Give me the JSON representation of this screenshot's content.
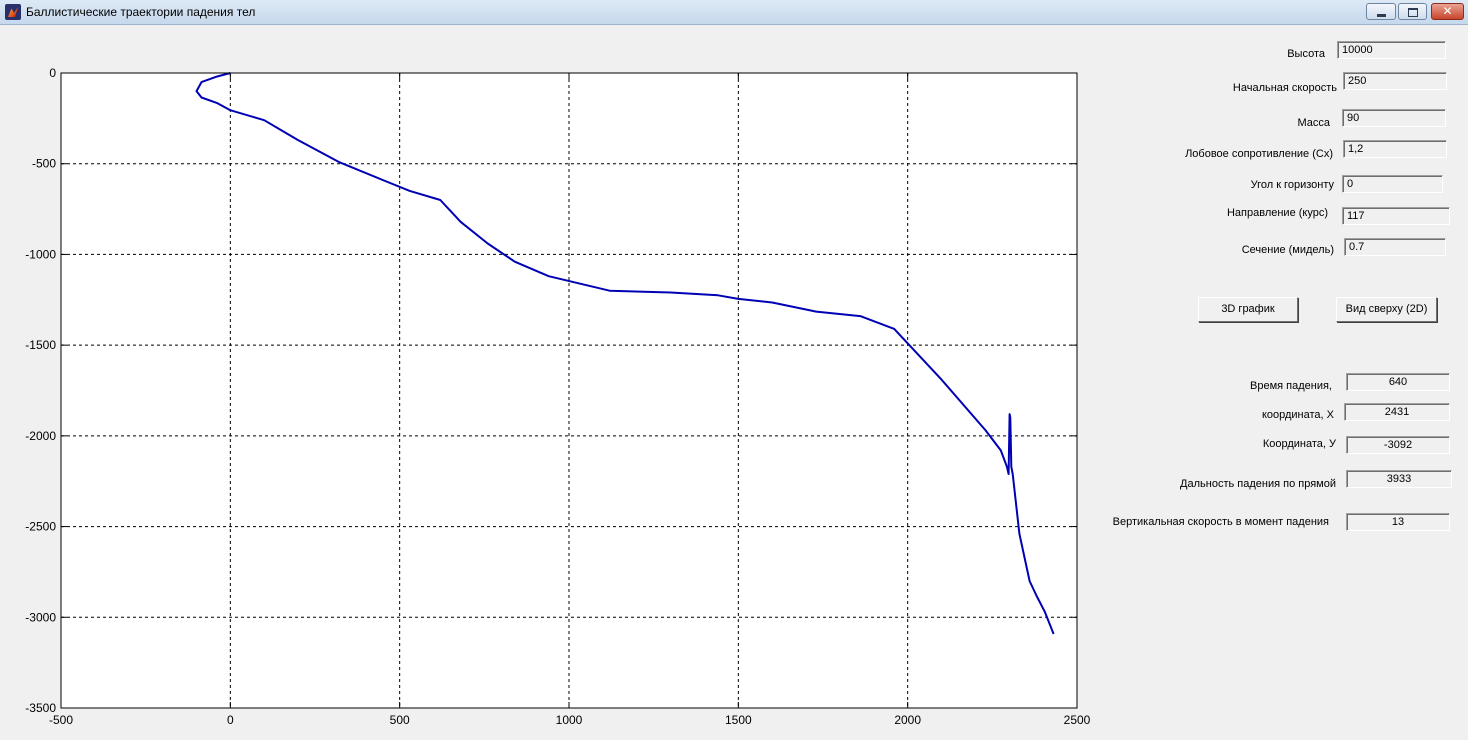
{
  "window": {
    "title": "Баллистические траектории падения тел"
  },
  "inputs": [
    {
      "label": "Высота",
      "value": "10000"
    },
    {
      "label": "Начальная скорость",
      "value": "250"
    },
    {
      "label": "Масса",
      "value": "90"
    },
    {
      "label": "Лобовое сопротивление (Cx)",
      "value": "1,2"
    },
    {
      "label": "Угол к горизонту",
      "value": "0"
    },
    {
      "label": "Направление  (курс)",
      "value": "117"
    },
    {
      "label": "Сечение (мидель)",
      "value": "0.7"
    }
  ],
  "buttons": {
    "plot3d": "3D график",
    "topview": "Вид сверху (2D)"
  },
  "results": [
    {
      "label": "Время падения,",
      "value": "640"
    },
    {
      "label": "координата, X",
      "value": "2431"
    },
    {
      "label": "Координата, У",
      "value": "-3092"
    },
    {
      "label": "Дальность падения по прямой",
      "value": "3933"
    },
    {
      "label": "Вертикальная  скорость в момент падения",
      "value": "13"
    }
  ],
  "chart_data": {
    "type": "line",
    "xlim": [
      -500,
      2500
    ],
    "ylim": [
      -3500,
      0
    ],
    "xticks": [
      -500,
      0,
      500,
      1000,
      1500,
      2000,
      2500
    ],
    "yticks": [
      0,
      -500,
      -1000,
      -1500,
      -2000,
      -2500,
      -3000,
      -3500
    ],
    "grid": true,
    "line_color": "#0000b4",
    "series": [
      {
        "x": [
          0,
          -40,
          -85,
          -100,
          -85,
          -40,
          0,
          100,
          200,
          320,
          450,
          530,
          620,
          680,
          760,
          840,
          940,
          1120,
          1300,
          1440,
          1500,
          1600,
          1730,
          1860,
          1960,
          2100,
          2230,
          2275,
          2293,
          2298,
          2301,
          2303,
          2306,
          2310,
          2330,
          2360,
          2380,
          2405,
          2431
        ],
        "y": [
          0,
          -20,
          -50,
          -100,
          -135,
          -165,
          -205,
          -260,
          -370,
          -490,
          -590,
          -650,
          -700,
          -820,
          -940,
          -1040,
          -1120,
          -1200,
          -1210,
          -1225,
          -1245,
          -1265,
          -1315,
          -1340,
          -1410,
          -1690,
          -1970,
          -2080,
          -2170,
          -2210,
          -1880,
          -1900,
          -2170,
          -2210,
          -2540,
          -2800,
          -2880,
          -2970,
          -3092
        ]
      }
    ]
  }
}
